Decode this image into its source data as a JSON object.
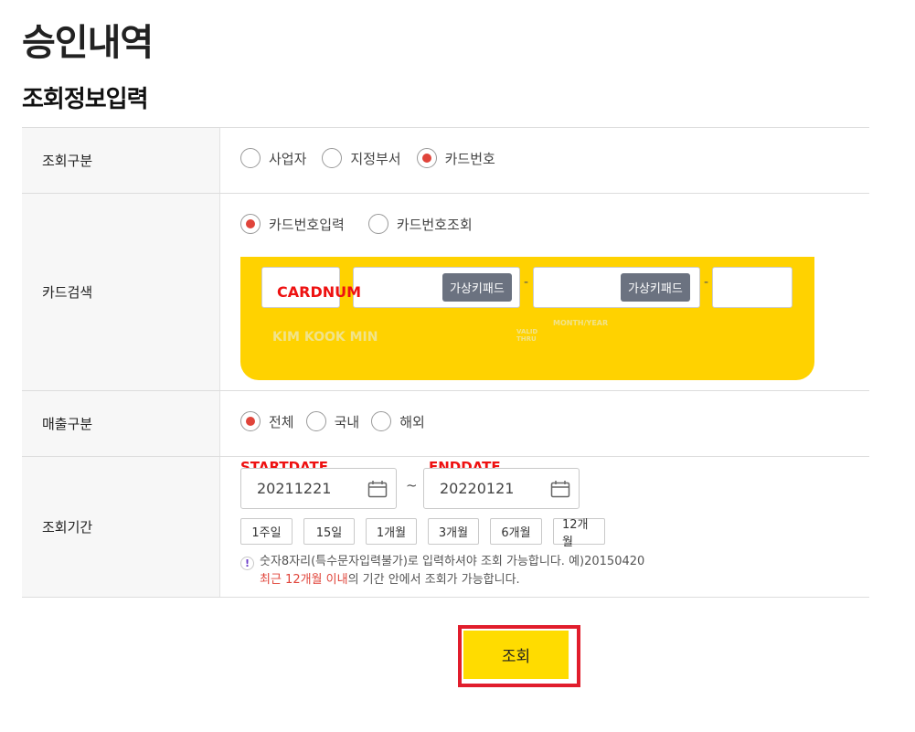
{
  "page_title": "승인내역",
  "section_title": "조회정보입력",
  "rows": {
    "inquiry_type": {
      "label": "조회구분",
      "options": [
        "사업자",
        "지정부서",
        "카드번호"
      ],
      "selected": "카드번호"
    },
    "card_search": {
      "label": "카드검색",
      "options": [
        "카드번호입력",
        "카드번호조회"
      ],
      "selected": "카드번호입력",
      "overlay_label": "CARDNUM",
      "virtual_keypad_label": "가상키패드",
      "dash": "-",
      "card_name": "KIM KOOK MIN",
      "valid_thru": "VALID THRU",
      "month_year": "MONTH/YEAR"
    },
    "sales_type": {
      "label": "매출구분",
      "options": [
        "전체",
        "국내",
        "해외"
      ],
      "selected": "전체"
    },
    "period": {
      "label": "조회기간",
      "start_overlay": "STARTDATE",
      "end_overlay": "ENDDATE",
      "start_date": "20211221",
      "end_date": "20220121",
      "tilde": "~",
      "buttons": [
        "1주일",
        "15일",
        "1개월",
        "3개월",
        "6개월",
        "12개월"
      ],
      "notice_line1": "숫자8자리(특수문자입력불가)로 입력하셔야 조회 가능합니다. 예)20150420",
      "notice_line2_red": "최근 12개월 이내",
      "notice_line2_rest": "의 기간 안에서 조회가 가능합니다."
    }
  },
  "search_button": "조회",
  "colors": {
    "accent_yellow": "#ffd200",
    "radio_red": "#e0443a",
    "highlight_red": "#e11d2c"
  }
}
